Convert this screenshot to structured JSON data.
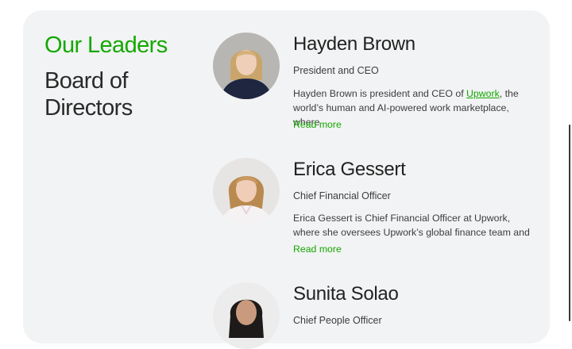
{
  "section": {
    "eyebrow": "Our Leaders",
    "heading_line1": "Board of",
    "heading_line2": "Directors"
  },
  "leaders": [
    {
      "name": "Hayden Brown",
      "role": "President and CEO",
      "bio_before_link": "Hayden Brown is president and CEO of ",
      "bio_link": "Upwork",
      "bio_after_link": ", the world’s human and AI-powered work marketplace, where",
      "read_more": "Read more"
    },
    {
      "name": "Erica Gessert",
      "role": "Chief Financial Officer",
      "bio": "Erica Gessert is Chief Financial Officer at Upwork, where she oversees Upwork’s global finance team and",
      "read_more": "Read more"
    },
    {
      "name": "Sunita Solao",
      "role": "Chief People Officer"
    }
  ],
  "colors": {
    "accent": "#14a800",
    "panel": "#f2f3f4"
  }
}
